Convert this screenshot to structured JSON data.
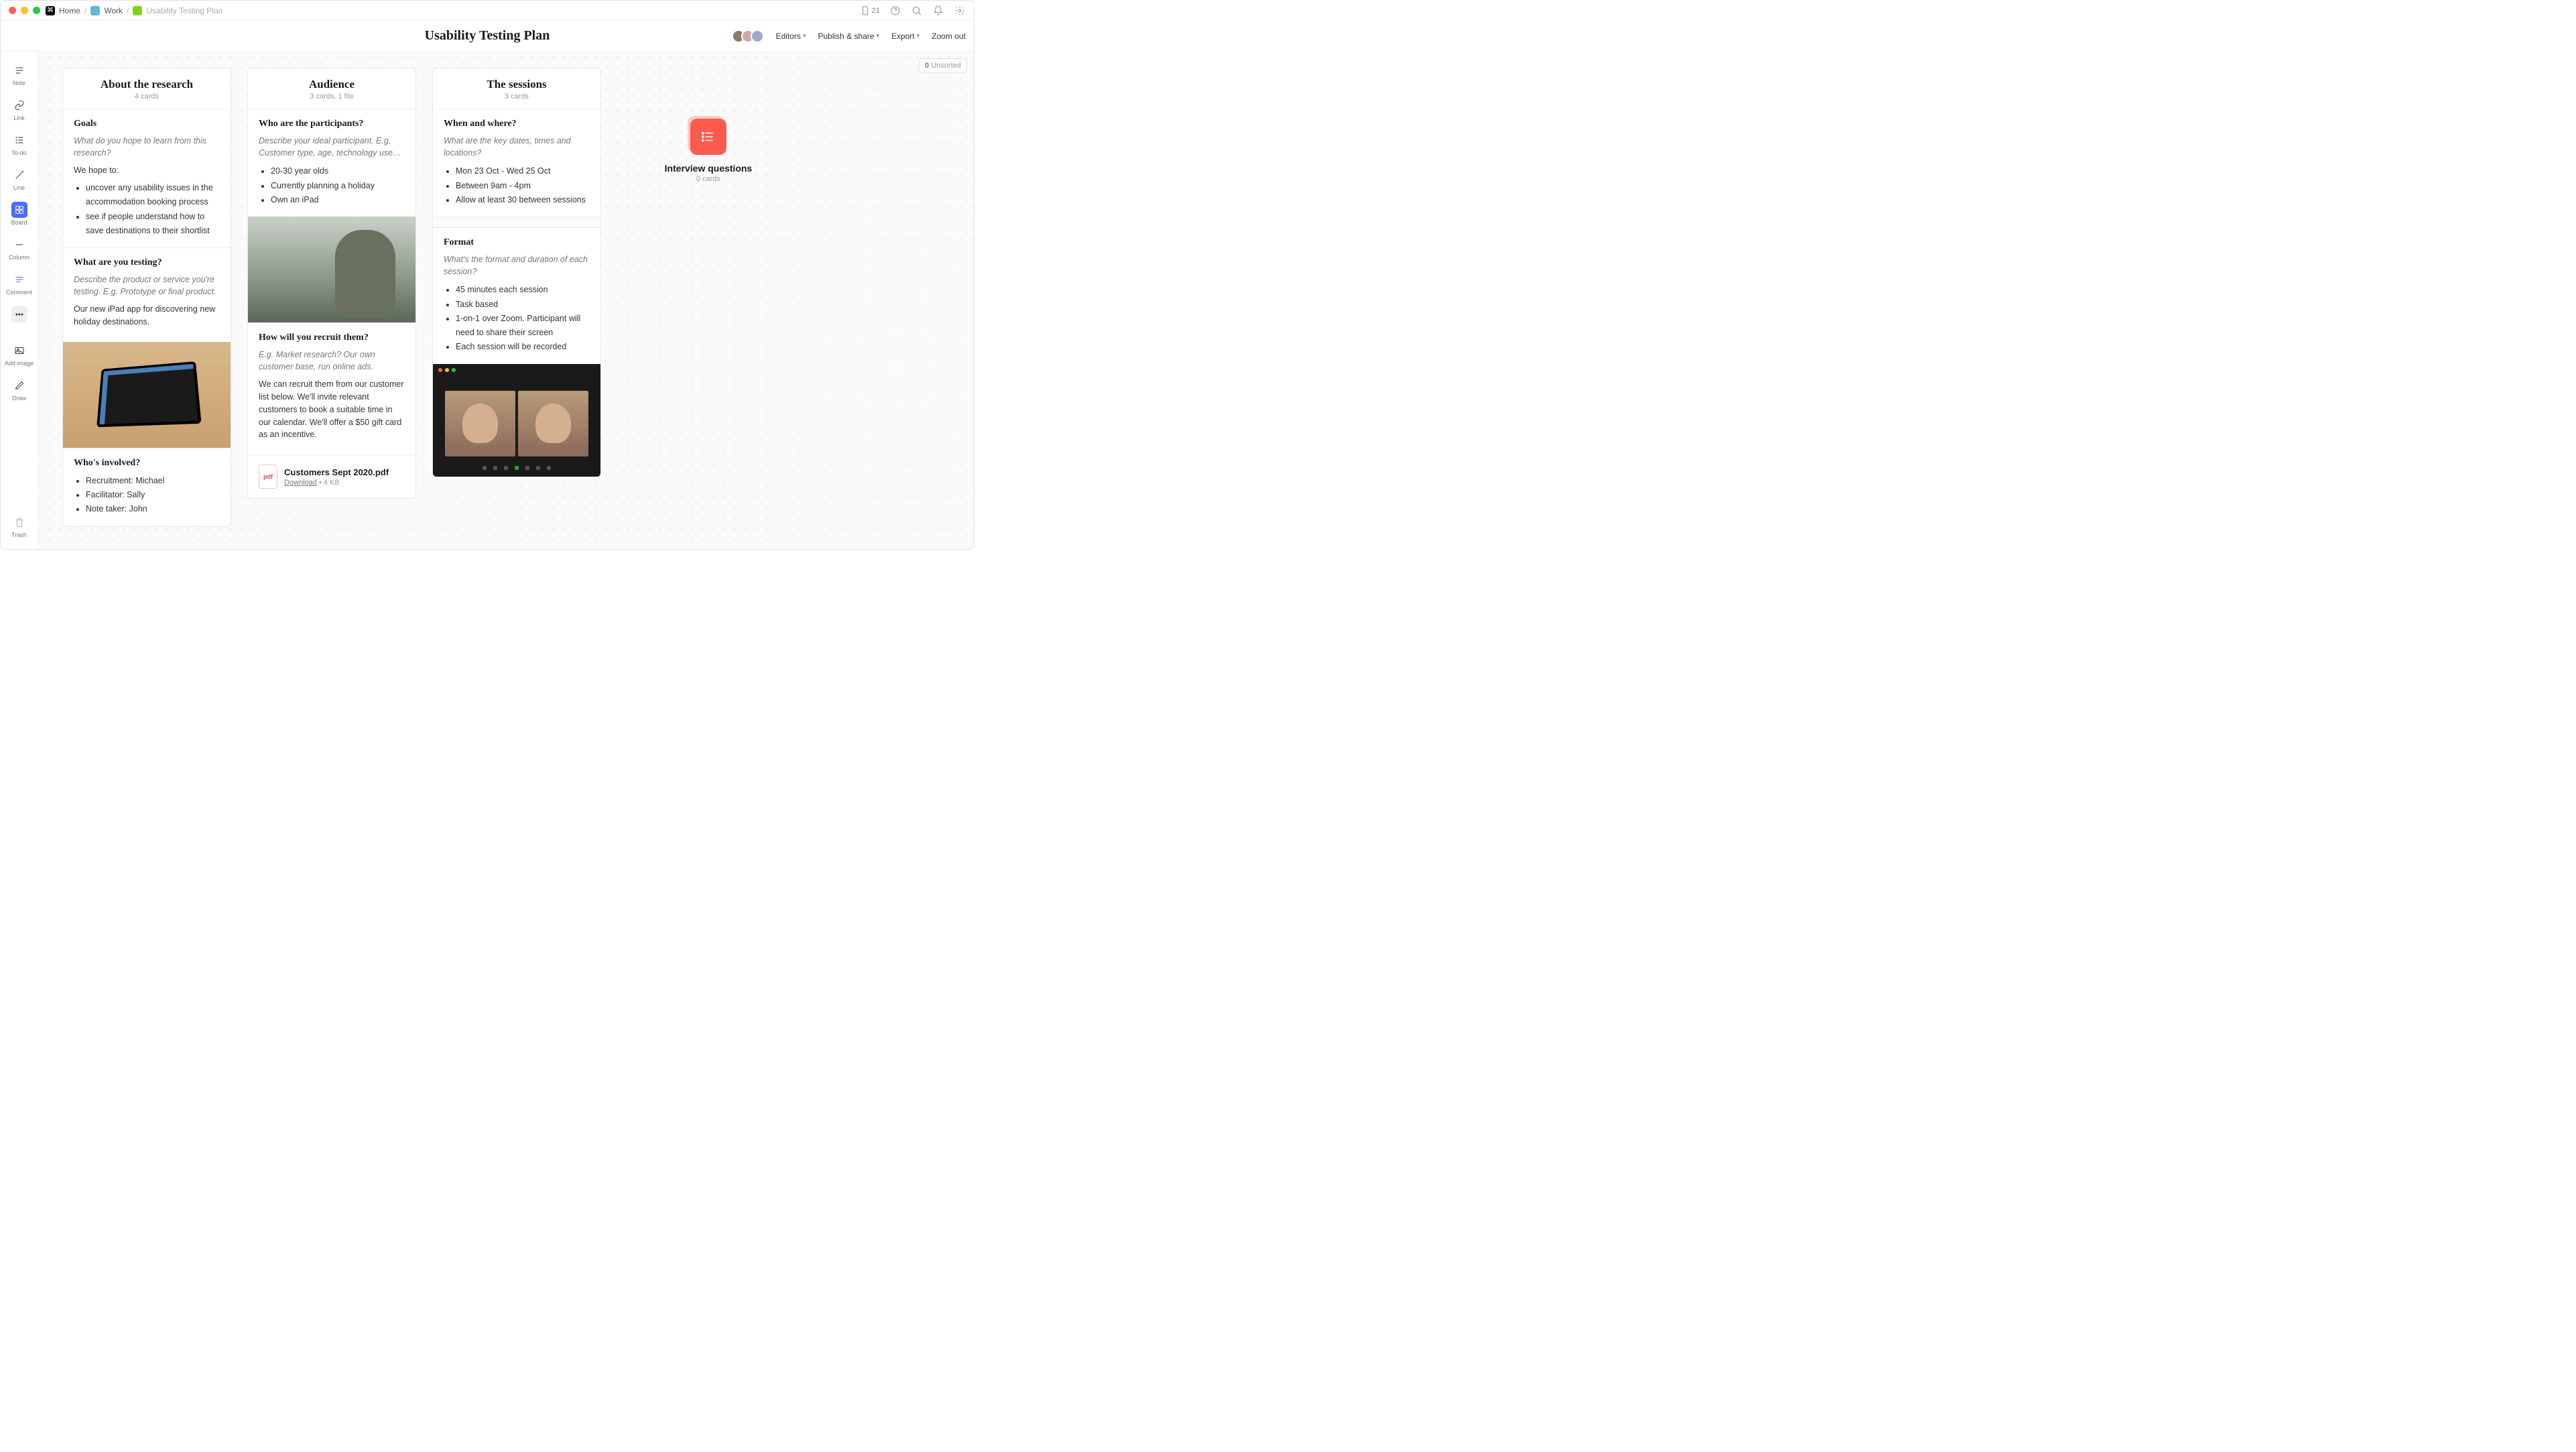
{
  "titlebar": {
    "home": "Home",
    "work": "Work",
    "page": "Usability Testing Plan",
    "device_count": "21"
  },
  "header": {
    "title": "Usability Testing Plan",
    "editors": "Editors",
    "publish": "Publish & share",
    "export": "Export",
    "zoom": "Zoom out"
  },
  "sidebar": {
    "note": "Note",
    "link": "Link",
    "todo": "To-do",
    "line": "Line",
    "board": "Board",
    "column": "Column",
    "comment": "Comment",
    "addimage": "Add image",
    "draw": "Draw",
    "trash": "Trash"
  },
  "unsorted": {
    "count": "0",
    "label": "Unsorted"
  },
  "columns": {
    "about": {
      "title": "About the research",
      "sub": "4 cards",
      "goals": {
        "title": "Goals",
        "prompt": "What do you hope to learn from this research?",
        "intro": "We hope to:",
        "items": [
          "uncover any usability issues in the accommodation booking process",
          "see if people understand how to save destinations to their shortlist"
        ]
      },
      "testing": {
        "title": "What are you testing?",
        "prompt": "Describe the product or service you're testing. E.g. Prototype or final product.",
        "body": "Our new iPad app for discovering new holiday destinations."
      },
      "involved": {
        "title": "Who's involved?",
        "items": [
          "Recruitment: Michael",
          "Facilitator: Sally",
          "Note taker: John"
        ]
      }
    },
    "audience": {
      "title": "Audience",
      "sub": "3 cards, 1 file",
      "participants": {
        "title": "Who are the participants?",
        "prompt": "Describe your ideal participant. E.g. Customer type, age, technology use…",
        "items": [
          "20-30 year olds",
          "Currently planning a holiday",
          "Own an iPad"
        ]
      },
      "recruit": {
        "title": "How will you recruit them?",
        "prompt": "E.g. Market research? Our own customer base, run online ads.",
        "body": "We can recruit them from our customer list below. We'll invite relevant customers to book a suitable time in our calendar. We'll offer a $50 gift card as an incentive."
      },
      "file": {
        "name": "Customers Sept 2020.pdf",
        "download": "Download",
        "size": "4 KB",
        "badge": "pdf"
      }
    },
    "sessions": {
      "title": "The sessions",
      "sub": "3 cards",
      "when": {
        "title": "When and where?",
        "prompt": "What are the key dates, times and locations?",
        "items": [
          "Mon 23 Oct - Wed 25 Oct",
          "Between 9am - 4pm",
          "Allow at least 30 between sessions"
        ]
      },
      "format": {
        "title": "Format",
        "prompt": "What's the format and duration of each session?",
        "items": [
          "45 minutes each session",
          "Task based",
          "1-on-1 over Zoom. Participant will need to share their screen",
          "Each session will be recorded"
        ]
      }
    }
  },
  "stack": {
    "title": "Interview questions",
    "sub": "0 cards"
  }
}
